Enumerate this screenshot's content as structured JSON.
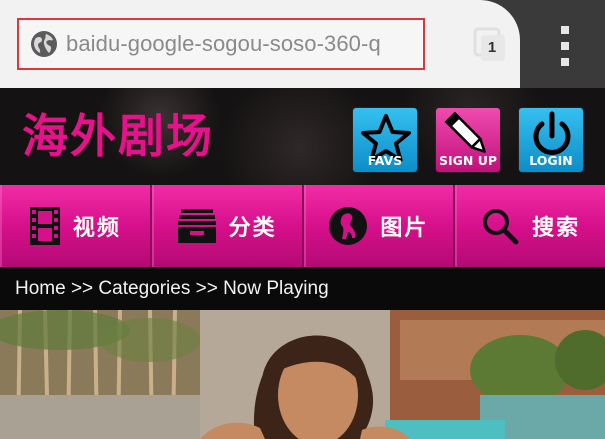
{
  "browser": {
    "url": "baidu-google-sogou-soso-360-q",
    "tab_count": "1",
    "icons": {
      "site": "globe-icon",
      "tabs": "tab-switcher-icon",
      "menu": "overflow-menu-icon"
    },
    "highlight_color": "#d9393b"
  },
  "site": {
    "logo_text": "海外剧场",
    "header_buttons": [
      {
        "label": "FAVS",
        "icon": "star-icon",
        "color": "#1aa6e0"
      },
      {
        "label": "SIGN UP",
        "icon": "pencil-icon",
        "color": "#e0229a"
      },
      {
        "label": "LOGIN",
        "icon": "power-icon",
        "color": "#1aa6e0"
      }
    ],
    "nav": [
      {
        "label": "视频",
        "icon": "film-icon"
      },
      {
        "label": "分类",
        "icon": "drawer-icon"
      },
      {
        "label": "图片",
        "icon": "silhouette-icon"
      },
      {
        "label": "搜索",
        "icon": "search-icon"
      }
    ],
    "breadcrumb": "Home >> Categories >> Now Playing",
    "colors": {
      "brand_pink": "#e4128c",
      "nav_pink": "#d6108a",
      "accent_blue": "#1aa6e0"
    }
  }
}
